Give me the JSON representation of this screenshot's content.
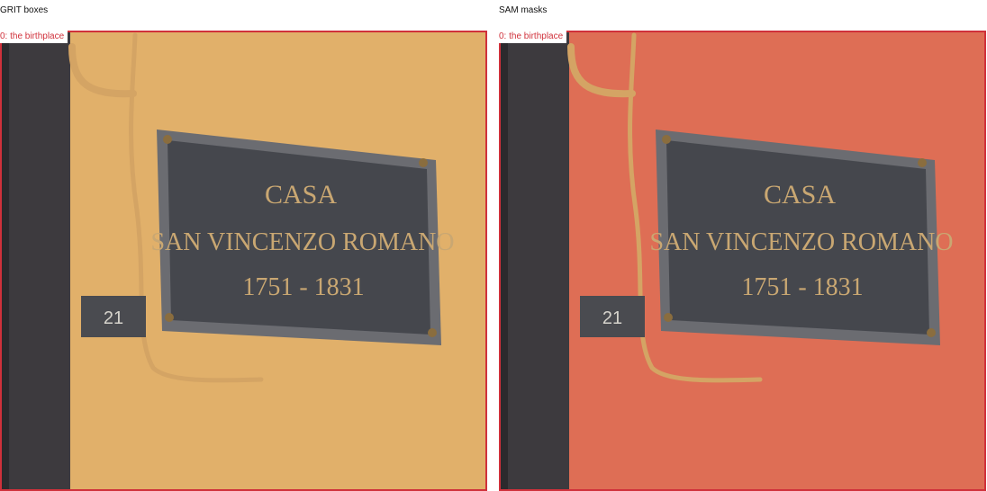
{
  "panels": [
    {
      "title": "GRIT boxes",
      "box_label": "0: the birthplace",
      "wall_color": "#e2b26c",
      "overlay": "none"
    },
    {
      "title": "SAM masks",
      "box_label": "0: the birthplace",
      "wall_color": "#de6e55",
      "overlay": "red mask"
    }
  ],
  "plaque": {
    "line1": "CASA",
    "line2": "SAN VINCENZO ROMANO",
    "line3": "1751 - 1831"
  },
  "house_number": "21",
  "colors": {
    "box": "#d0313b",
    "plaque": "#45474d",
    "dark_wall": "#3d3a3e",
    "pipe": "#d4a464"
  }
}
